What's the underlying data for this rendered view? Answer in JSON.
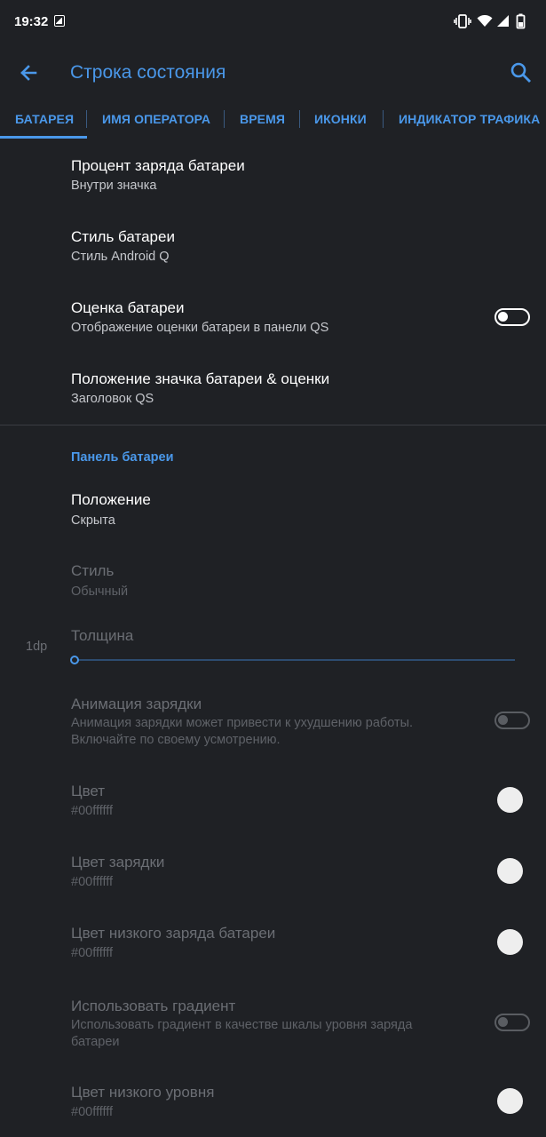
{
  "status_bar": {
    "time": "19:32",
    "icons": [
      "photo-notification-icon",
      "vibrate-icon",
      "wifi-icon",
      "signal-icon",
      "battery-icon"
    ]
  },
  "app_bar": {
    "title": "Строка состояния",
    "back_icon": "arrow-left-icon",
    "search_icon": "search-icon"
  },
  "tabs": [
    {
      "label": "БАТАРЕЯ",
      "active": true
    },
    {
      "label": "ИМЯ ОПЕРАТОРА",
      "active": false
    },
    {
      "label": "ВРЕМЯ",
      "active": false
    },
    {
      "label": "ИКОНКИ",
      "active": false
    },
    {
      "label": "ИНДИКАТОР ТРАФИКА",
      "active": false
    }
  ],
  "settings": [
    {
      "title": "Процент заряда батареи",
      "subtitle": "Внутри значка"
    },
    {
      "title": "Стиль батареи",
      "subtitle": "Стиль Android Q"
    },
    {
      "title": "Оценка батареи",
      "subtitle": "Отображение оценки батареи в панели QS",
      "switch": false
    },
    {
      "title": "Положение значка батареи & оценки",
      "subtitle": "Заголовок QS"
    }
  ],
  "category": "Панель батареи",
  "bar_settings": {
    "position": {
      "title": "Положение",
      "subtitle": "Скрыта"
    },
    "style": {
      "title": "Стиль",
      "subtitle": "Обычный",
      "enabled": false
    },
    "thickness": {
      "title": "Толщина",
      "value_label": "1dp",
      "slider_fraction": 0.0,
      "enabled": false
    },
    "charge_animation": {
      "title": "Анимация зарядки",
      "subtitle_line1": "Анимация зарядки может привести к ухудшению работы.",
      "subtitle_line2": "Включайте по своему усмотрению.",
      "switch": false,
      "enabled": false
    },
    "color": {
      "title": "Цвет",
      "subtitle": "#00ffffff",
      "enabled": false
    },
    "charging_color": {
      "title": "Цвет зарядки",
      "subtitle": "#00ffffff",
      "enabled": false
    },
    "low_color": {
      "title": "Цвет низкого заряда батареи",
      "subtitle": "#00ffffff",
      "enabled": false
    },
    "gradient": {
      "title": "Использовать градиент",
      "subtitle_line1": "Использовать градиент в качестве шкалы уровня заряда",
      "subtitle_line2": "батареи",
      "switch": false,
      "enabled": false
    },
    "low_level_color": {
      "title": "Цвет низкого уровня",
      "subtitle": "#00ffffff",
      "enabled": false
    }
  },
  "colors": {
    "background": "#1f2125",
    "accent": "#4a98ea",
    "text_primary": "#ffffff",
    "text_disabled": "#6b6e74"
  }
}
